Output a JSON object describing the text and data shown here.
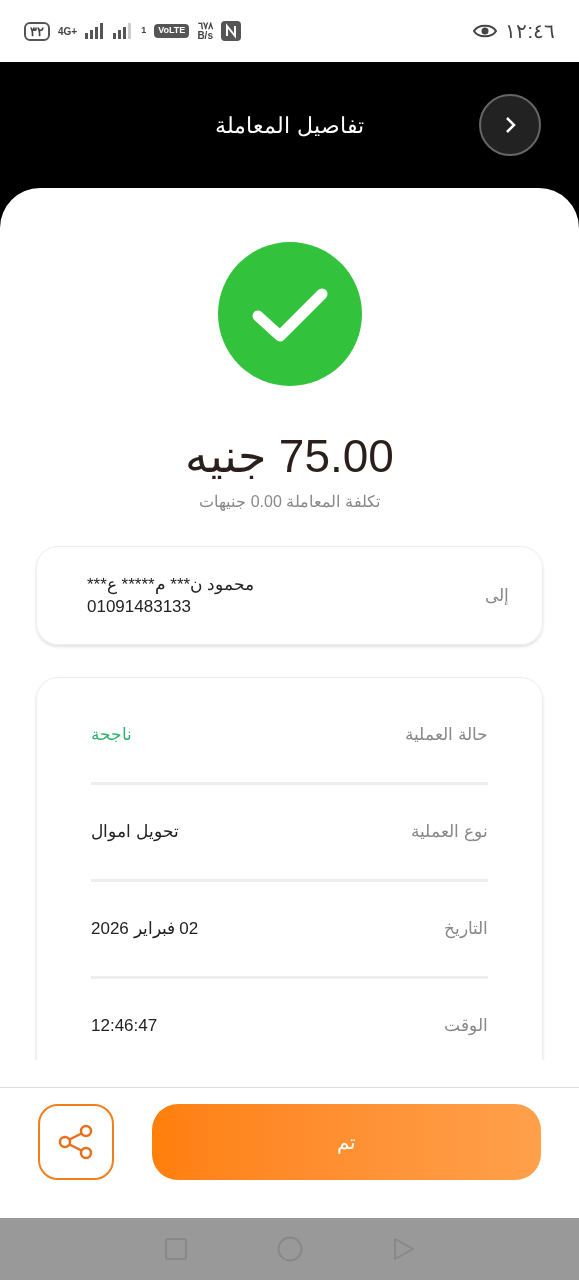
{
  "status_bar": {
    "time": "١٢:٤٦",
    "data_speed": "٦٧٨",
    "data_unit": "B/s",
    "volte": "VoLTE",
    "network": "4G+",
    "sim": "1",
    "battery": "٣٢"
  },
  "header": {
    "title": "تفاصيل المعاملة"
  },
  "amount": "75.00 جنيه",
  "fee": "تكلفة المعاملة 0.00 جنيهات",
  "recipient": {
    "label": "إلى",
    "name": "محمود ن*** م***** ع***",
    "phone": "01091483133"
  },
  "details": [
    {
      "label": "حالة العملية",
      "value": "ناجحة",
      "kind": "status"
    },
    {
      "label": "نوع العملية",
      "value": "تحويل اموال",
      "kind": "text"
    },
    {
      "label": "التاريخ",
      "value": "02 فبراير 2026",
      "kind": "text"
    },
    {
      "label": "الوقت",
      "value": "12:46:47",
      "kind": "text"
    }
  ],
  "done_button": "تم"
}
